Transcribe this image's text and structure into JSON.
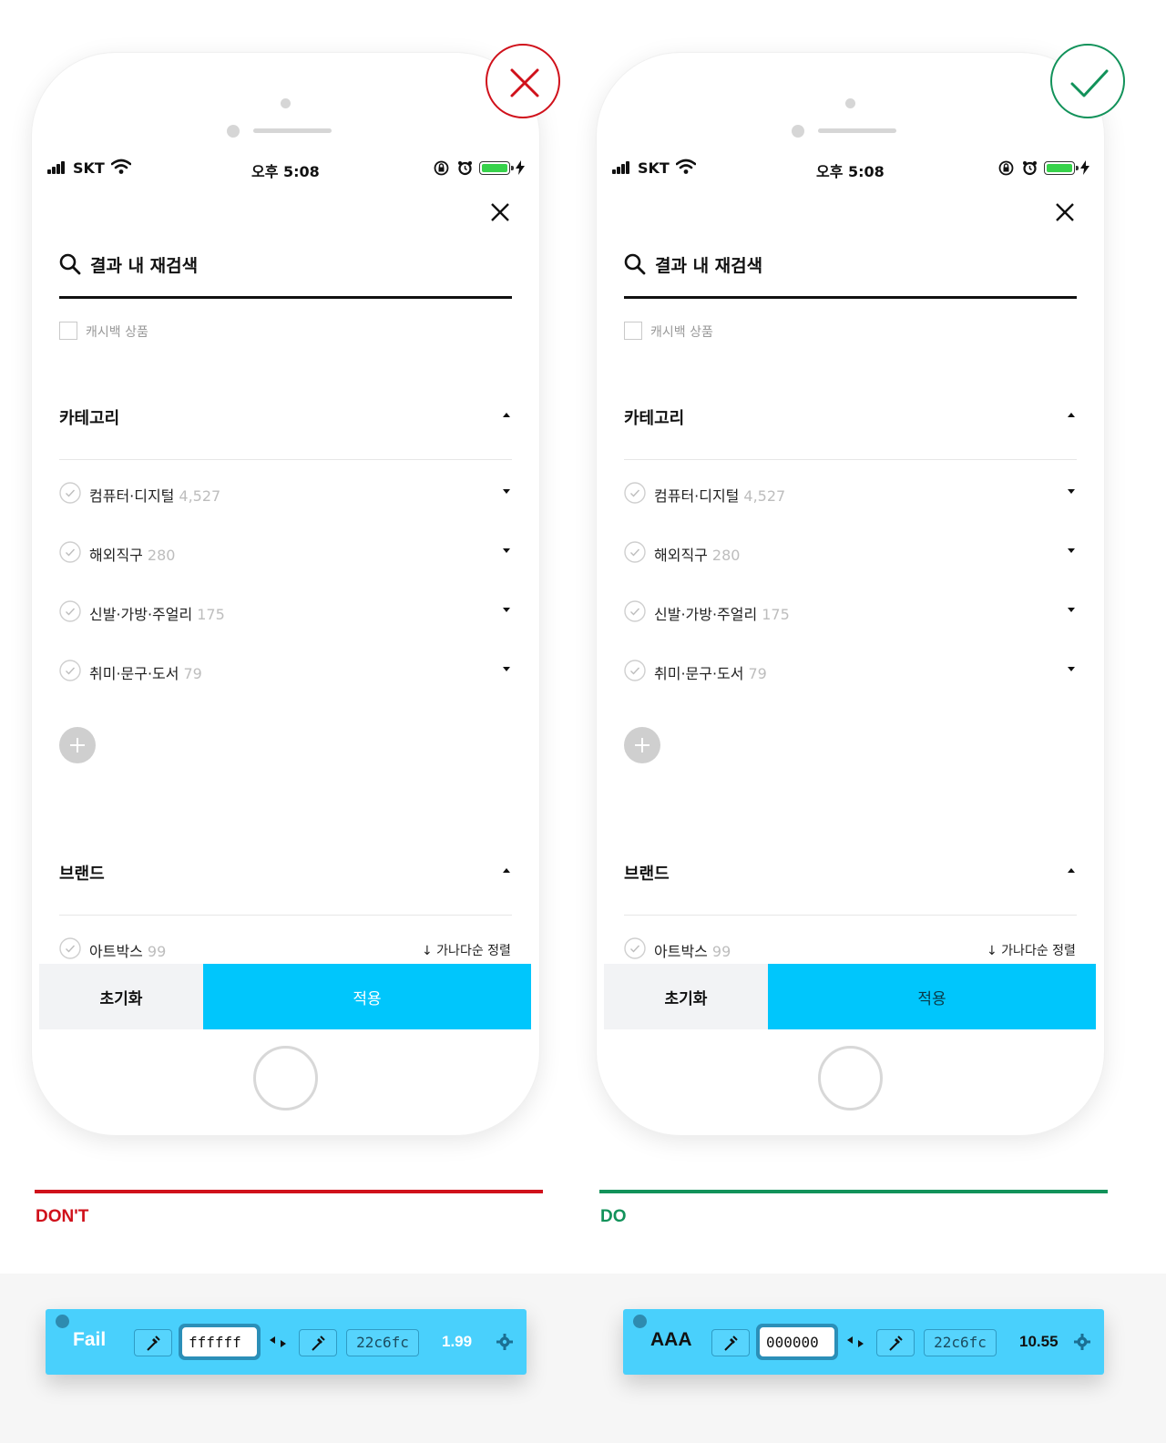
{
  "panels": {
    "dont": {
      "status": {
        "carrier": "SKT",
        "time": "오후 5:08"
      },
      "search": {
        "label": "결과 내 재검색"
      },
      "cashback": {
        "label": "캐시백 상품"
      },
      "category": {
        "title": "카테고리",
        "items": [
          {
            "name": "컴퓨터·디지털",
            "count": "4,527"
          },
          {
            "name": "해외직구",
            "count": "280"
          },
          {
            "name": "신발·가방·주얼리",
            "count": "175"
          },
          {
            "name": "취미·문구·도서",
            "count": "79"
          }
        ]
      },
      "brand": {
        "title": "브랜드",
        "item": {
          "name": "아트박스",
          "count": "99"
        },
        "sort_label": "↓ 가나다순 정렬"
      },
      "footer": {
        "reset": "초기화",
        "apply": "적용"
      },
      "verdict": "DON'T"
    },
    "do": {
      "status": {
        "carrier": "SKT",
        "time": "오후 5:08"
      },
      "search": {
        "label": "결과 내 재검색"
      },
      "cashback": {
        "label": "캐시백 상품"
      },
      "category": {
        "title": "카테고리",
        "items": [
          {
            "name": "컴퓨터·디지털",
            "count": "4,527"
          },
          {
            "name": "해외직구",
            "count": "280"
          },
          {
            "name": "신발·가방·주얼리",
            "count": "175"
          },
          {
            "name": "취미·문구·도서",
            "count": "79"
          }
        ]
      },
      "brand": {
        "title": "브랜드",
        "item": {
          "name": "아트박스",
          "count": "99"
        },
        "sort_label": "↓ 가나다순 정렬"
      },
      "footer": {
        "reset": "초기화",
        "apply": "적용"
      },
      "verdict": "DO"
    }
  },
  "checkers": {
    "dont": {
      "grade": "Fail",
      "foreground": "ffffff",
      "background": "22c6fc",
      "ratio": "1.99"
    },
    "do": {
      "grade": "AAA",
      "foreground": "000000",
      "background": "22c6fc",
      "ratio": "10.55"
    }
  },
  "colors": {
    "apply_button": "#00c6fc",
    "dont_accent": "#d0111b",
    "do_accent": "#12925a",
    "apply_text_dont": "#ffffff",
    "apply_text_do": "#0a3a48",
    "checker_bar": "#49d0fc"
  },
  "icons": [
    "signal-icon",
    "wifi-icon",
    "lock-rotation-icon",
    "alarm-icon",
    "battery-icon",
    "charging-bolt-icon",
    "close-icon",
    "search-icon",
    "check-circle-icon",
    "plus-icon",
    "caret-up-icon",
    "caret-down-icon",
    "x-mark-icon",
    "check-mark-icon",
    "eyedropper-icon",
    "swap-icon",
    "gear-icon"
  ]
}
